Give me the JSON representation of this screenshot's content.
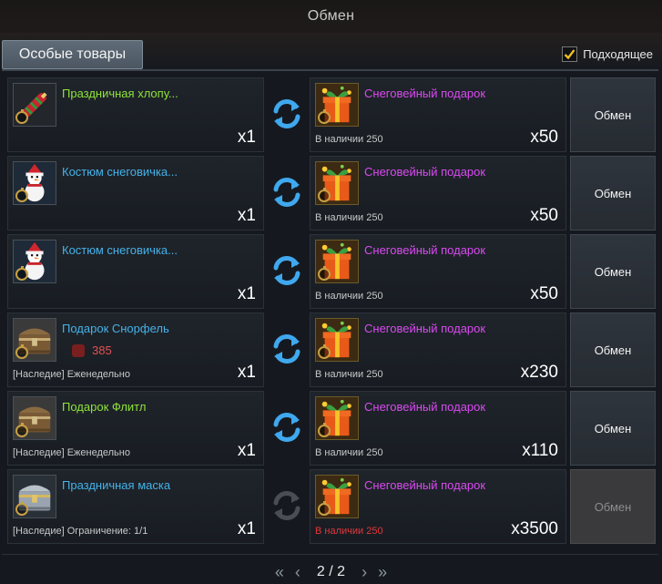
{
  "window": {
    "title": "Обмен"
  },
  "tabs": {
    "special_goods": "Особые товары"
  },
  "filter": {
    "suitable_label": "Подходящее",
    "checked": true
  },
  "rows": [
    {
      "give": {
        "name": "Праздничная хлопу...",
        "quality": "green",
        "icon": "firecracker-icon",
        "qty": "x1",
        "sub": "",
        "cost": ""
      },
      "get": {
        "name": "Снеговейный подарок",
        "icon": "gift-icon",
        "qty": "x50",
        "stock": "В наличии 250",
        "stock_warning": false
      },
      "button": "Обмен",
      "enabled": true
    },
    {
      "give": {
        "name": "Костюм снеговичка...",
        "quality": "blue",
        "icon": "snowman-icon",
        "qty": "x1",
        "sub": "",
        "cost": ""
      },
      "get": {
        "name": "Снеговейный подарок",
        "icon": "gift-icon",
        "qty": "x50",
        "stock": "В наличии 250",
        "stock_warning": false
      },
      "button": "Обмен",
      "enabled": true
    },
    {
      "give": {
        "name": "Костюм снеговичка...",
        "quality": "blue",
        "icon": "snowman-icon",
        "qty": "x1",
        "sub": "",
        "cost": ""
      },
      "get": {
        "name": "Снеговейный подарок",
        "icon": "gift-icon",
        "qty": "x50",
        "stock": "В наличии 250",
        "stock_warning": false
      },
      "button": "Обмен",
      "enabled": true
    },
    {
      "give": {
        "name": "Подарок Снорфель",
        "quality": "blue",
        "icon": "chest-icon",
        "qty": "x1",
        "sub": "[Наследие] Еженедельно",
        "cost": "385"
      },
      "get": {
        "name": "Снеговейный подарок",
        "icon": "gift-icon",
        "qty": "x230",
        "stock": "В наличии 250",
        "stock_warning": false
      },
      "button": "Обмен",
      "enabled": true
    },
    {
      "give": {
        "name": "Подарок Флитл",
        "quality": "green",
        "icon": "chest-icon",
        "qty": "x1",
        "sub": "[Наследие] Еженедельно",
        "cost": ""
      },
      "get": {
        "name": "Снеговейный подарок",
        "icon": "gift-icon",
        "qty": "x110",
        "stock": "В наличии 250",
        "stock_warning": false
      },
      "button": "Обмен",
      "enabled": true
    },
    {
      "give": {
        "name": "Праздничная маска",
        "quality": "blue",
        "icon": "mask-chest-icon",
        "qty": "x1",
        "sub": "[Наследие] Ограничение: 1/1",
        "cost": ""
      },
      "get": {
        "name": "Снеговейный подарок",
        "icon": "gift-icon",
        "qty": "x3500",
        "stock": "В наличии 250",
        "stock_warning": true
      },
      "button": "Обмен",
      "enabled": false
    }
  ],
  "pagination": {
    "current": "2 / 2",
    "first": "«",
    "prev": "‹",
    "next": "›",
    "last": "»"
  },
  "colors": {
    "green": "#8fe33a",
    "blue": "#45b2e8",
    "purple": "#d94bf0",
    "warning": "#e2373a",
    "arrow_active": "#3fa8ee",
    "arrow_inactive": "#4a4d52"
  }
}
